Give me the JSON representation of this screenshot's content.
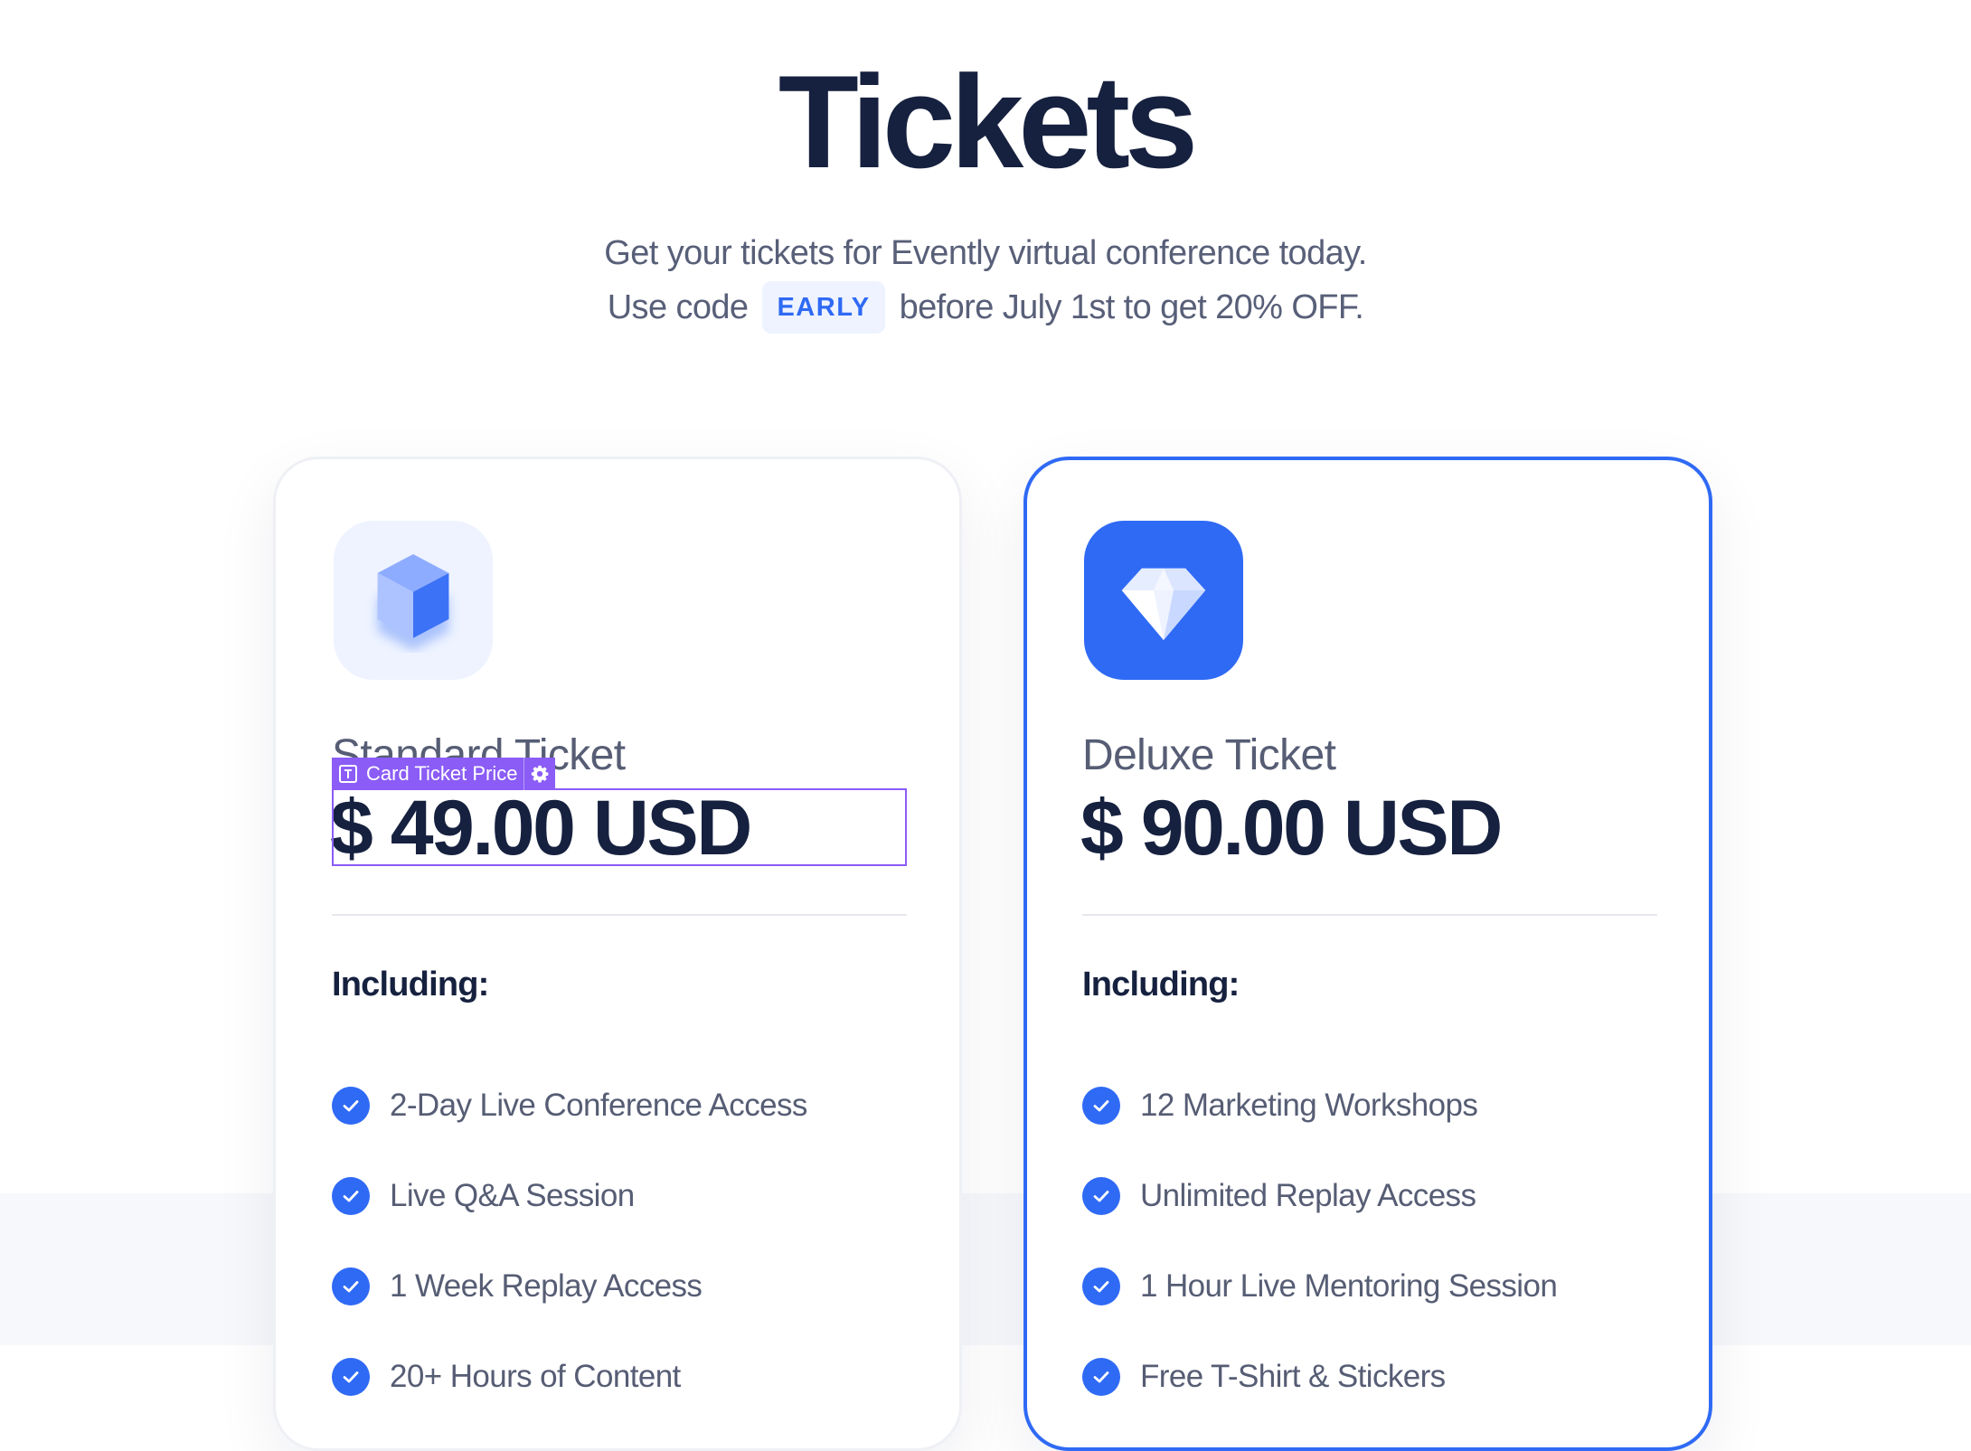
{
  "header": {
    "title": "Tickets",
    "subtitle_line1": "Get your tickets for Evently virtual conference today.",
    "subtitle_pre": "Use code",
    "promo_code": "EARLY",
    "subtitle_post": "before July 1st to get 20% OFF."
  },
  "editor_overlay": {
    "label": "Card Ticket Price",
    "type_icon": "text-icon",
    "settings_icon": "gear-icon"
  },
  "cards": [
    {
      "name": "Standard Ticket",
      "price": "$ 49.00 USD",
      "icon": "cube-icon",
      "including_label": "Including:",
      "features": [
        "2-Day Live Conference Access",
        "Live Q&A Session",
        "1 Week Replay Access",
        "20+ Hours of Content"
      ]
    },
    {
      "name": "Deluxe Ticket",
      "price": "$ 90.00 USD",
      "icon": "diamond-icon",
      "including_label": "Including:",
      "features": [
        "12 Marketing Workshops",
        "Unlimited Replay Access",
        "1 Hour Live Mentoring Session",
        "Free T-Shirt & Stickers"
      ]
    }
  ],
  "colors": {
    "accent": "#2f6af5",
    "heading": "#16213f",
    "body_text": "#565d74",
    "selection": "#8b5cf6"
  }
}
